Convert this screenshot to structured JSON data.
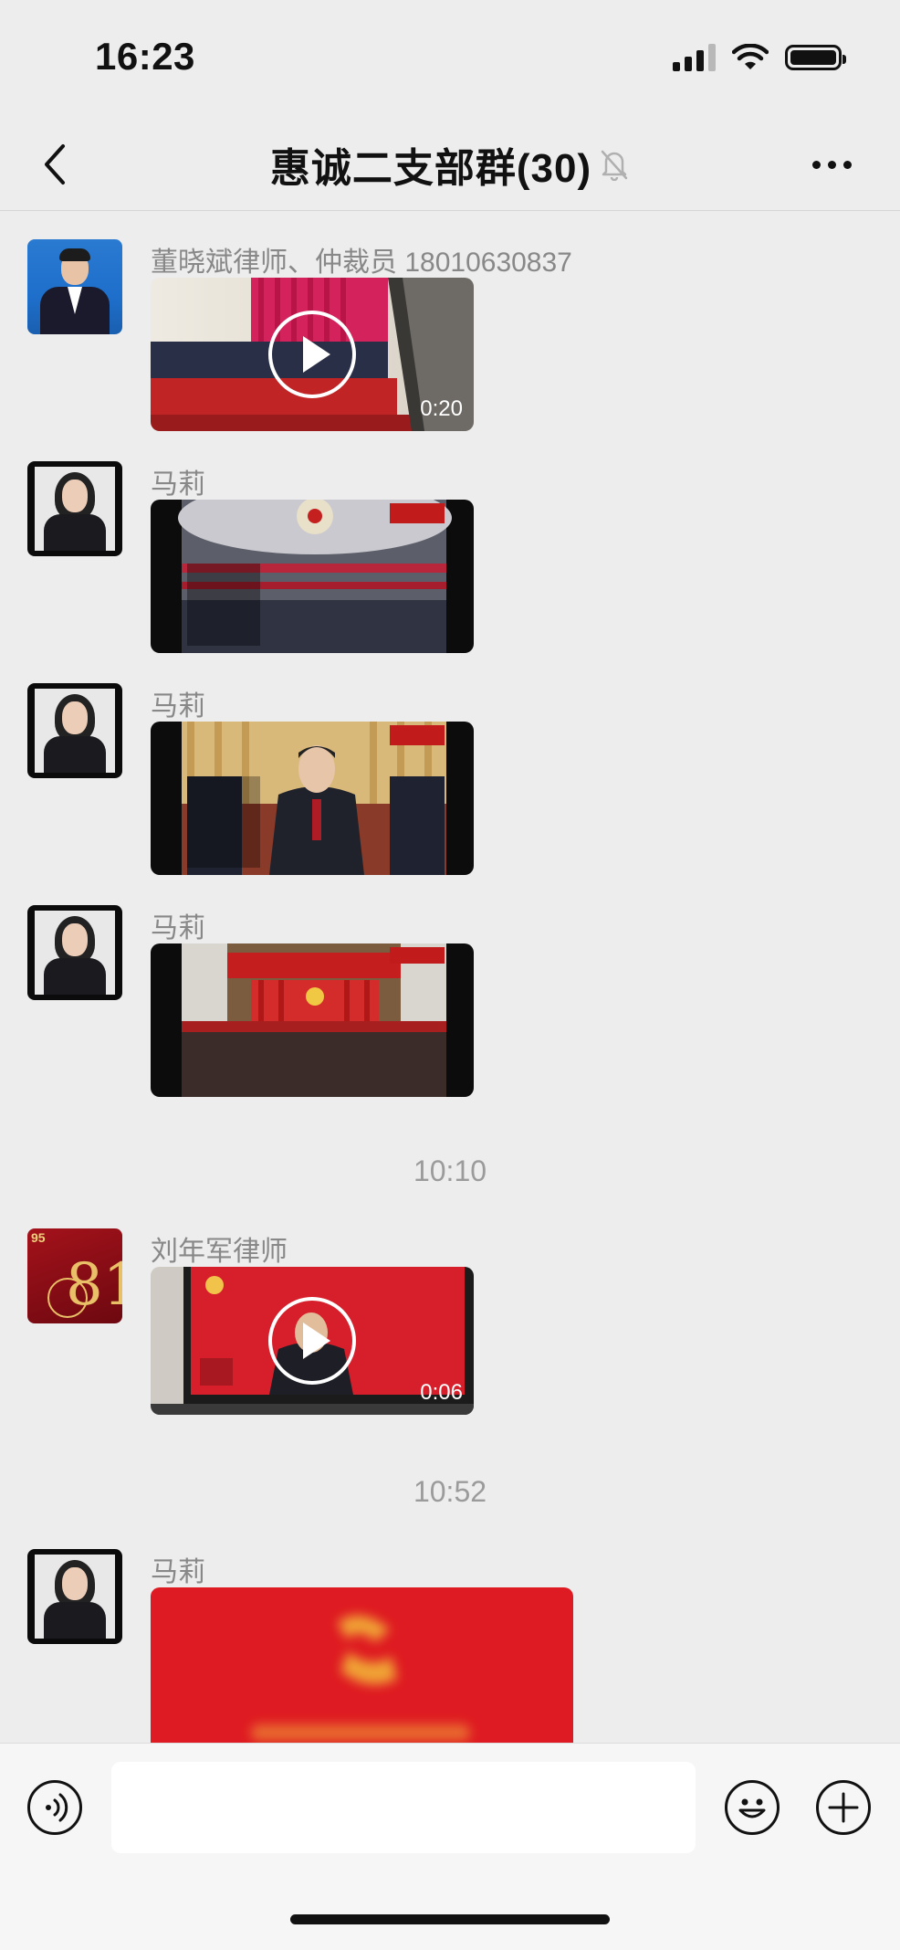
{
  "status_bar": {
    "time": "16:23"
  },
  "nav": {
    "title": "惠诚二支部群(30)"
  },
  "messages": [
    {
      "sender": "董晓斌律师、仲裁员 18010630837",
      "media": "video",
      "duration": "0:20"
    },
    {
      "sender": "马莉",
      "media": "video"
    },
    {
      "sender": "马莉",
      "media": "video"
    },
    {
      "sender": "马莉",
      "media": "video"
    },
    {
      "sender": "刘年军律师",
      "media": "video",
      "duration": "0:06"
    },
    {
      "sender": "马莉",
      "media": "image"
    }
  ],
  "timestamps": [
    "10:10",
    "10:52"
  ],
  "input": {
    "placeholder": ""
  },
  "icons": {
    "back": "chevron-left-icon",
    "mute": "bell-slash-icon",
    "more": "more-icon",
    "voice": "voice-icon",
    "emoji": "emoji-icon",
    "plus": "plus-icon"
  }
}
